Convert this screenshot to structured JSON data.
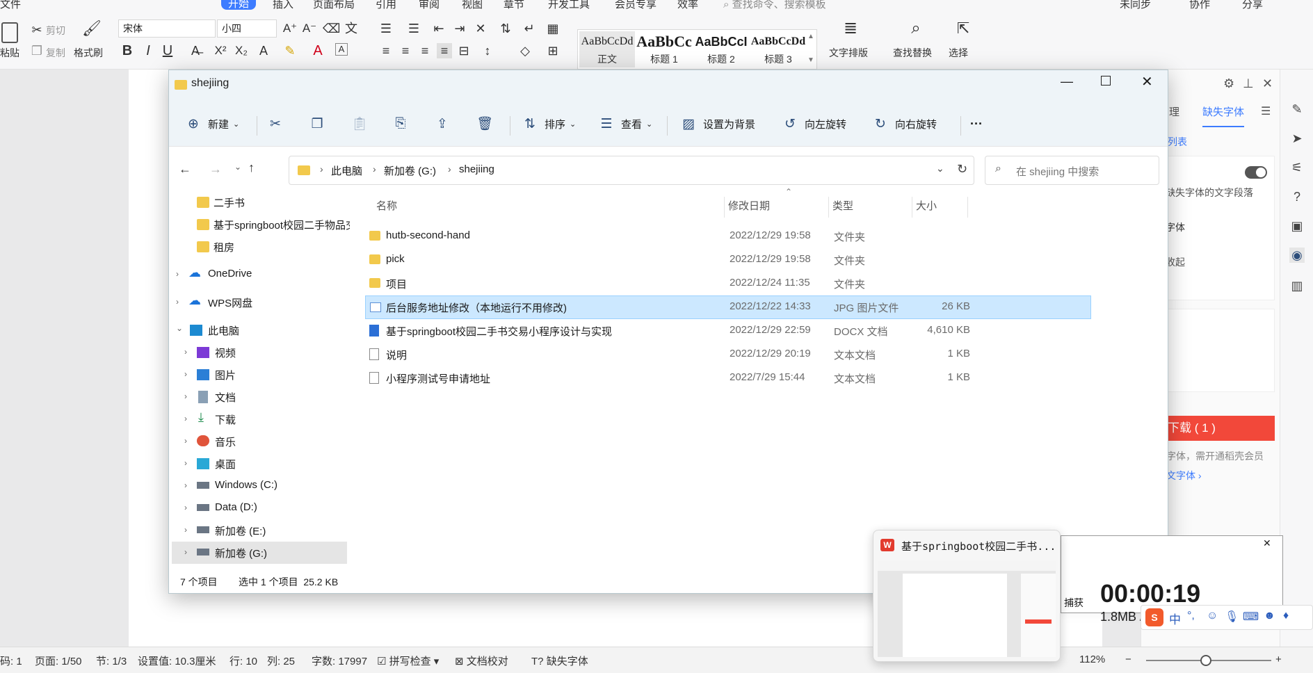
{
  "wps": {
    "menu": [
      "文件",
      "开始",
      "插入",
      "页面布局",
      "引用",
      "审阅",
      "视图",
      "章节",
      "开发工具",
      "会员专享",
      "效率"
    ],
    "menu_search": "查找命令、搜索模板",
    "top_right": [
      "未同步",
      "协作",
      "分享"
    ],
    "ribbon": {
      "paste": "粘贴",
      "cut": "剪切",
      "copy": "复制",
      "format_painter": "格式刷",
      "font_name": "宋体",
      "font_size": "小四",
      "styles": [
        {
          "sample": "AaBbCcDd",
          "name": "正文"
        },
        {
          "sample": "AaBbCc",
          "name": "标题 1"
        },
        {
          "sample": "AaBbCcI",
          "name": "标题 2"
        },
        {
          "sample": "AaBbCcDd",
          "name": "标题 3"
        }
      ],
      "text_layout": "文字排版",
      "find_replace": "查找替换",
      "select": "选择"
    },
    "panel": {
      "tabs": [
        "理",
        "缺失字体"
      ],
      "list_label": "列表",
      "desc": "缺失字体的文字段落",
      "font_label": "字体",
      "collapse": "收起",
      "download_btn": "下载 ( 1 )",
      "note": "字体，需开通稻壳会员",
      "link": "文字体"
    },
    "status": {
      "page_code": "码: 1",
      "page": "页面: 1/50",
      "section": "节: 1/3",
      "setting": "设置值: 10.3厘米",
      "line": "行: 10",
      "col": "列: 25",
      "words": "字数: 17997",
      "spell": "拼写检查",
      "proof": "文档校对",
      "missing_font": "缺失字体",
      "zoom": "112%"
    }
  },
  "explorer": {
    "title": "shejiing",
    "toolbar": {
      "new": "新建",
      "sort": "排序",
      "view": "查看",
      "set_bg": "设置为背景",
      "rotate_left": "向左旋转",
      "rotate_right": "向右旋转",
      "more": "···"
    },
    "breadcrumb": [
      "此电脑",
      "新加卷 (G:)",
      "shejiing"
    ],
    "search_placeholder": "在 shejiing 中搜索",
    "nav": [
      {
        "label": "二手书",
        "kind": "folder"
      },
      {
        "label": "基于springboot校园二手物品交易",
        "kind": "folder"
      },
      {
        "label": "租房",
        "kind": "folder"
      },
      {
        "label": "OneDrive",
        "kind": "cloud"
      },
      {
        "label": "WPS网盘",
        "kind": "cloud"
      },
      {
        "label": "此电脑",
        "kind": "pc"
      },
      {
        "label": "视频",
        "kind": "video"
      },
      {
        "label": "图片",
        "kind": "image"
      },
      {
        "label": "文档",
        "kind": "doc"
      },
      {
        "label": "下载",
        "kind": "download"
      },
      {
        "label": "音乐",
        "kind": "music"
      },
      {
        "label": "桌面",
        "kind": "desktop"
      },
      {
        "label": "Windows (C:)",
        "kind": "drive"
      },
      {
        "label": "Data (D:)",
        "kind": "drive"
      },
      {
        "label": "新加卷 (E:)",
        "kind": "drive"
      },
      {
        "label": "新加卷 (G:)",
        "kind": "drive"
      }
    ],
    "columns": [
      "名称",
      "修改日期",
      "类型",
      "大小"
    ],
    "files": [
      {
        "name": "hutb-second-hand",
        "date": "2022/12/29 19:58",
        "type": "文件夹",
        "size": "",
        "kind": "folder"
      },
      {
        "name": "pick",
        "date": "2022/12/29 19:58",
        "type": "文件夹",
        "size": "",
        "kind": "folder"
      },
      {
        "name": "项目",
        "date": "2022/12/24 11:35",
        "type": "文件夹",
        "size": "",
        "kind": "folder"
      },
      {
        "name": "后台服务地址修改（本地运行不用修改)",
        "date": "2022/12/22 14:33",
        "type": "JPG 图片文件",
        "size": "26 KB",
        "kind": "image"
      },
      {
        "name": "基于springboot校园二手书交易小程序设计与实现",
        "date": "2022/12/29 22:59",
        "type": "DOCX 文档",
        "size": "4,610 KB",
        "kind": "docx"
      },
      {
        "name": "说明",
        "date": "2022/12/29 20:19",
        "type": "文本文档",
        "size": "1 KB",
        "kind": "txt"
      },
      {
        "name": "小程序测试号申请地址",
        "date": "2022/7/29 15:44",
        "type": "文本文档",
        "size": "1 KB",
        "kind": "txt"
      }
    ],
    "status_count": "7 个项目",
    "status_selected": "选中 1 个项目  25.2 KB"
  },
  "taskbar_preview": {
    "title": "基于springboot校园二手书..."
  },
  "recorder": {
    "time": "00:00:19",
    "size": "1.8MB /",
    "capture_label": "捕获"
  },
  "ime": {
    "label": "中"
  }
}
